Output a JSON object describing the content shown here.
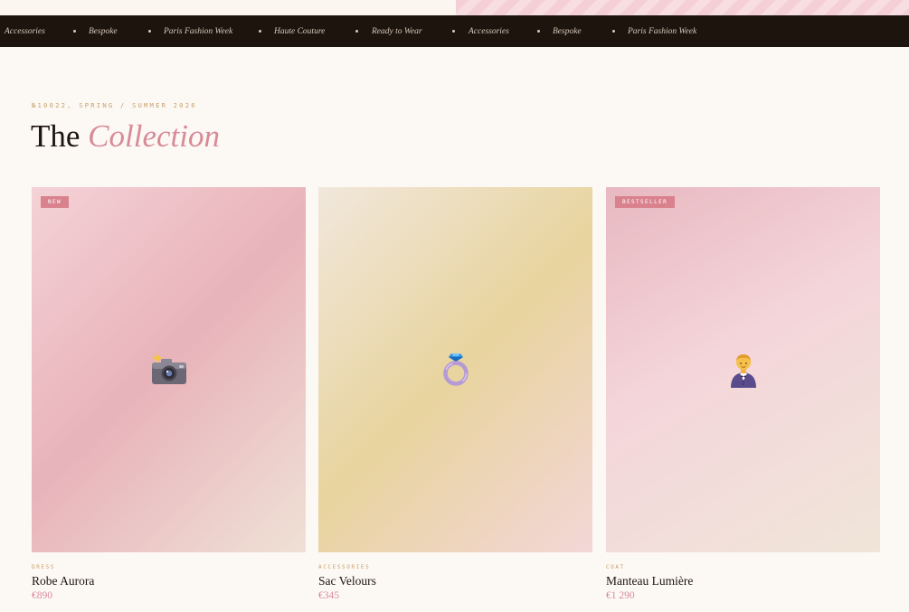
{
  "marquee": {
    "items": [
      "Accessories",
      "Bespoke",
      "Paris Fashion Week",
      "Haute Couture",
      "Ready to Wear",
      "Accessories",
      "Bespoke",
      "Paris Fashion Week"
    ]
  },
  "section": {
    "eyebrow": "№10022, SPRING / SUMMER 2026",
    "title_plain": "The",
    "title_accent": "Collection"
  },
  "products": [
    {
      "badge": "NEW",
      "icon": "camera-with-flash-icon",
      "category": "DRESS",
      "name": "Robe Aurora",
      "price": "€890",
      "gradient": [
        "#f4d2d6",
        "#e8b3ba",
        "#efe1d6"
      ]
    },
    {
      "badge": "",
      "icon": "ring-icon",
      "category": "ACCESSORIES",
      "name": "Sac Velours",
      "price": "€345",
      "gradient": [
        "#f1e7dc",
        "#e8d49e",
        "#f3d6d7"
      ]
    },
    {
      "badge": "BESTSELLER",
      "icon": "person-in-tuxedo-icon",
      "category": "COAT",
      "name": "Manteau Lumière",
      "price": "€1 290",
      "gradient": [
        "#e8b8c0",
        "#f4d6da",
        "#f0e5d9"
      ]
    }
  ],
  "colors": {
    "page_background": "#fcf9f5",
    "marquee_background": "#1d140e",
    "accent_pink": "#d98a97",
    "gold": "#c9a06a",
    "badge_background": "#d9828e"
  }
}
